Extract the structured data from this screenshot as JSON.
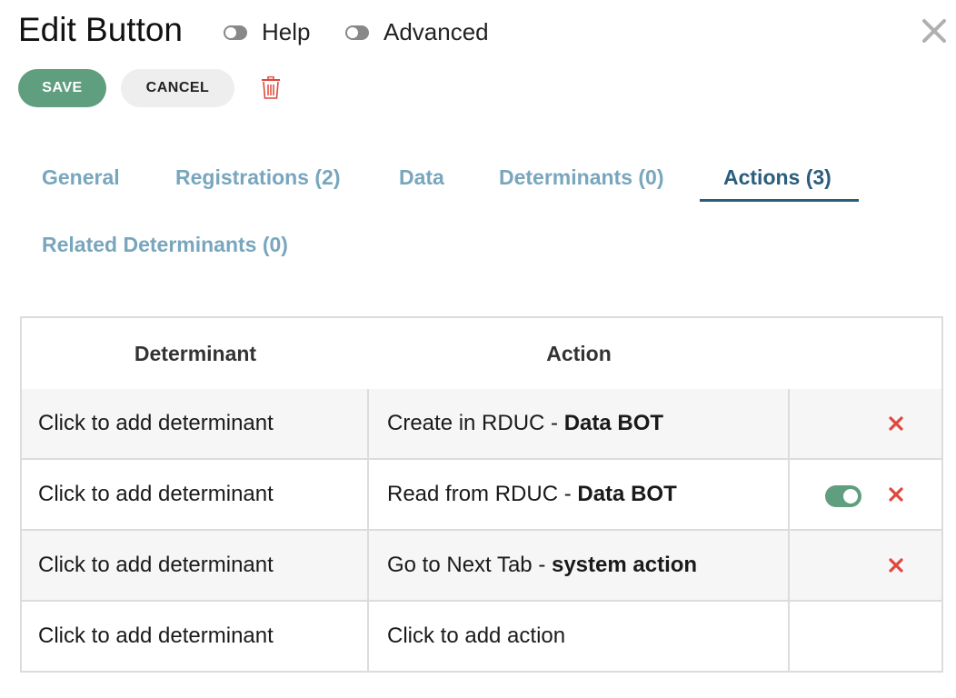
{
  "header": {
    "title": "Edit Button",
    "toggles": [
      {
        "label": "Help",
        "state": "off"
      },
      {
        "label": "Advanced",
        "state": "off"
      }
    ]
  },
  "toolbar": {
    "save_label": "SAVE",
    "cancel_label": "CANCEL"
  },
  "tabs": [
    {
      "label": "General",
      "active": false
    },
    {
      "label": "Registrations (2)",
      "active": false
    },
    {
      "label": "Data",
      "active": false
    },
    {
      "label": "Determinants (0)",
      "active": false
    },
    {
      "label": "Actions (3)",
      "active": true
    },
    {
      "label": "Related Determinants (0)",
      "active": false
    }
  ],
  "table": {
    "headers": [
      "Determinant",
      "Action"
    ],
    "rows": [
      {
        "determinant": "Click to add determinant",
        "action_text": "Create in RDUC - ",
        "action_bold": "Data BOT",
        "toggle": false,
        "delete": true
      },
      {
        "determinant": "Click to add determinant",
        "action_text": "Read from RDUC - ",
        "action_bold": "Data BOT",
        "toggle": true,
        "delete": true
      },
      {
        "determinant": "Click to add determinant",
        "action_text": "Go to Next Tab - ",
        "action_bold": "system action",
        "toggle": false,
        "delete": true
      },
      {
        "determinant": "Click to add determinant",
        "action_text": "Click to add action",
        "action_bold": "",
        "toggle": false,
        "delete": false
      }
    ]
  },
  "colors": {
    "accent_green": "#5f9e7e",
    "tab_inactive": "#78a6bd",
    "tab_active": "#2b5d7d",
    "delete_red": "#e0473c"
  },
  "icons": [
    "close-icon",
    "trash-icon",
    "delete-x-icon"
  ]
}
